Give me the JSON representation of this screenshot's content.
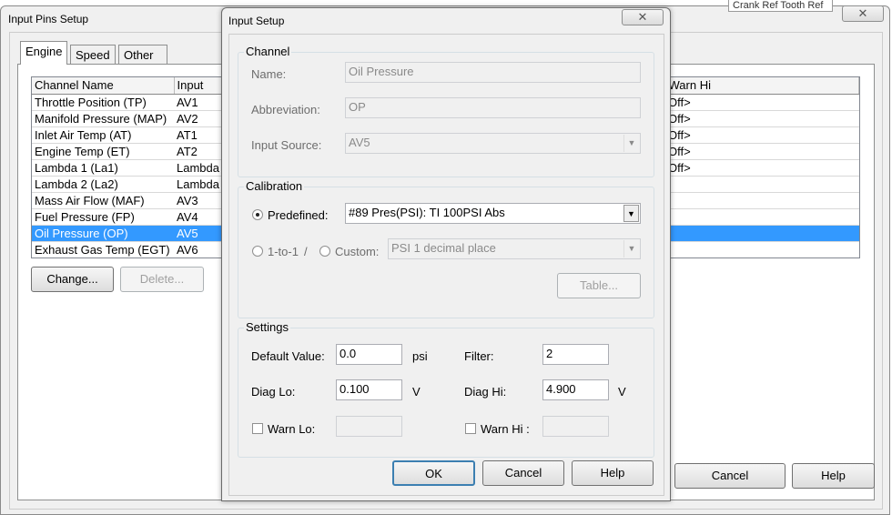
{
  "background_window": {
    "title": "Input Pins Setup",
    "behind_list_text": "Crank Ref Tooth Ref",
    "tabs": [
      {
        "label": "Engine",
        "active": true
      },
      {
        "label": "Speed",
        "active": false
      },
      {
        "label": "Other",
        "active": false
      }
    ],
    "table": {
      "columns": [
        "Channel Name",
        "Input",
        "Warn Hi"
      ],
      "rows": [
        {
          "name": "Throttle Position  (TP)",
          "input": "AV1",
          "warn_hi": "Off>"
        },
        {
          "name": "Manifold Pressure  (MAP)",
          "input": "AV2",
          "warn_hi": "Off>"
        },
        {
          "name": "Inlet Air Temp  (AT)",
          "input": "AT1",
          "warn_hi": "Off>"
        },
        {
          "name": "Engine Temp  (ET)",
          "input": "AT2",
          "warn_hi": "Off>"
        },
        {
          "name": "Lambda 1  (La1)",
          "input": "Lambda",
          "warn_hi": "Off>"
        },
        {
          "name": "Lambda 2  (La2)",
          "input": "Lambda",
          "warn_hi": ""
        },
        {
          "name": "Mass Air Flow  (MAF)",
          "input": "AV3",
          "warn_hi": ""
        },
        {
          "name": "Fuel Pressure  (FP)",
          "input": "AV4",
          "warn_hi": ""
        },
        {
          "name": "Oil Pressure  (OP)",
          "input": "AV5",
          "warn_hi": "",
          "selected": true
        },
        {
          "name": "Exhaust Gas Temp  (EGT)",
          "input": "AV6",
          "warn_hi": ""
        }
      ]
    },
    "buttons": {
      "change": "Change...",
      "delete": "Delete...",
      "cancel": "Cancel",
      "help": "Help"
    },
    "close_icon": "close-icon"
  },
  "dialog": {
    "title": "Input Setup",
    "channel": {
      "group_label": "Channel",
      "name_label": "Name:",
      "name_value": "Oil Pressure",
      "abbr_label": "Abbreviation:",
      "abbr_value": "OP",
      "source_label": "Input Source:",
      "source_value": "AV5"
    },
    "calibration": {
      "group_label": "Calibration",
      "predefined_label": "Predefined:",
      "predefined_value": "#89 Pres(PSI): TI 100PSI Abs",
      "predefined_checked": true,
      "one_to_one_label": "1-to-1",
      "slash": "/",
      "custom_label": "Custom:",
      "custom_value": "PSI 1 decimal place",
      "table_button": "Table..."
    },
    "settings": {
      "group_label": "Settings",
      "default_label": "Default Value:",
      "default_value": "0.0",
      "default_unit": "psi",
      "filter_label": "Filter:",
      "filter_value": "2",
      "diag_lo_label": "Diag Lo:",
      "diag_lo_value": "0.100",
      "diag_lo_unit": "V",
      "diag_hi_label": "Diag Hi:",
      "diag_hi_value": "4.900",
      "diag_hi_unit": "V",
      "warn_lo_label": "Warn Lo:",
      "warn_lo_checked": false,
      "warn_lo_value": "",
      "warn_hi_label": "Warn Hi :",
      "warn_hi_checked": false,
      "warn_hi_value": ""
    },
    "buttons": {
      "ok": "OK",
      "cancel": "Cancel",
      "help": "Help"
    }
  }
}
